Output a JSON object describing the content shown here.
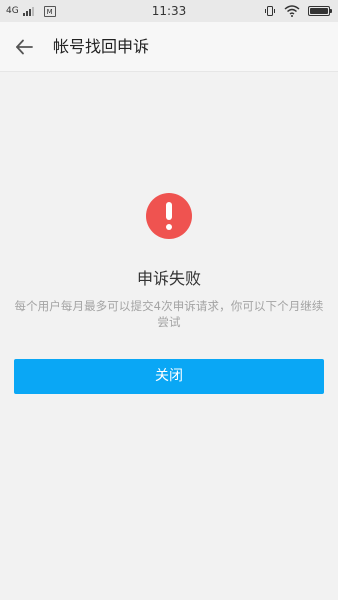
{
  "status_bar": {
    "network": "4G",
    "sim_label": "M",
    "time": "11:33"
  },
  "header": {
    "back_icon": "arrow-left-icon",
    "title": "帐号找回申诉"
  },
  "result": {
    "icon": "exclamation-circle-icon",
    "icon_color": "#ef5350",
    "title": "申诉失败",
    "description": "每个用户每月最多可以提交4次申诉请求，你可以下个月继续尝试"
  },
  "actions": {
    "close_label": "关闭",
    "close_color": "#0aa7f5"
  }
}
